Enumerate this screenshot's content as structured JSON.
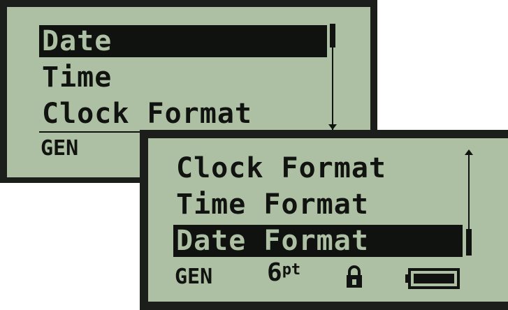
{
  "screen_one": {
    "menu_items": [
      {
        "label": "Date",
        "selected": true
      },
      {
        "label": "Time",
        "selected": false
      },
      {
        "label": "Clock Format",
        "selected": false
      }
    ],
    "status_mode": "GEN"
  },
  "screen_two": {
    "menu_items": [
      {
        "label": "Clock Format",
        "selected": false
      },
      {
        "label": "Time Format",
        "selected": false
      },
      {
        "label": "Date Format",
        "selected": true
      }
    ],
    "status": {
      "mode": "GEN",
      "font_size_number": "6",
      "font_size_unit": "pt",
      "lock_icon": "lock-icon",
      "battery_icon": "battery-icon",
      "battery_level": 1.0
    }
  },
  "colors": {
    "lcd_background": "#aec0a3",
    "lcd_ink": "#111311",
    "bezel": "#1b1e1b"
  }
}
